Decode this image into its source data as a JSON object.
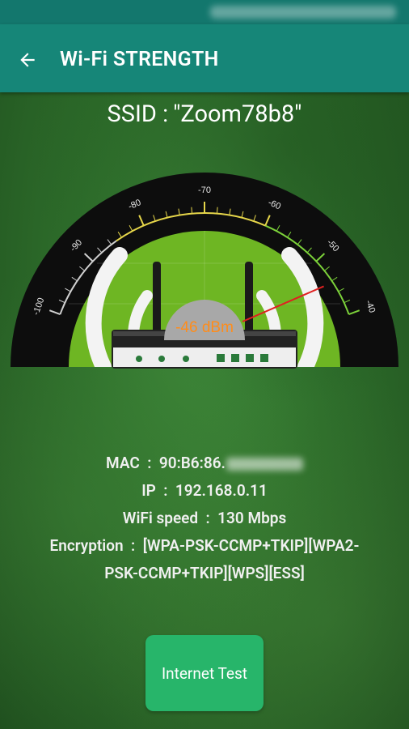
{
  "appbar": {
    "title": "Wi-Fi STRENGTH"
  },
  "ssid": {
    "label": "SSID :",
    "value": "\"Zoom78b8\""
  },
  "gauge": {
    "ticks": [
      "-100",
      "-90",
      "-80",
      "-70",
      "-60",
      "-50",
      "-40"
    ],
    "reading": "-46 dBm",
    "reading_value": -46,
    "accent_color": "#8ccf2e",
    "needle_color": "#e02020"
  },
  "info": {
    "mac_label": "MAC",
    "mac_value": "90:B6:86.",
    "ip_label": "IP",
    "ip_value": "192.168.0.11",
    "speed_label": "WiFi speed",
    "speed_value": "130 Mbps",
    "enc_label": "Encryption",
    "enc_value_line1": "[WPA-PSK-CCMP+TKIP][WPA2-",
    "enc_value_line2": "PSK-CCMP+TKIP][WPS][ESS]"
  },
  "button": {
    "label": "Internet Test"
  }
}
